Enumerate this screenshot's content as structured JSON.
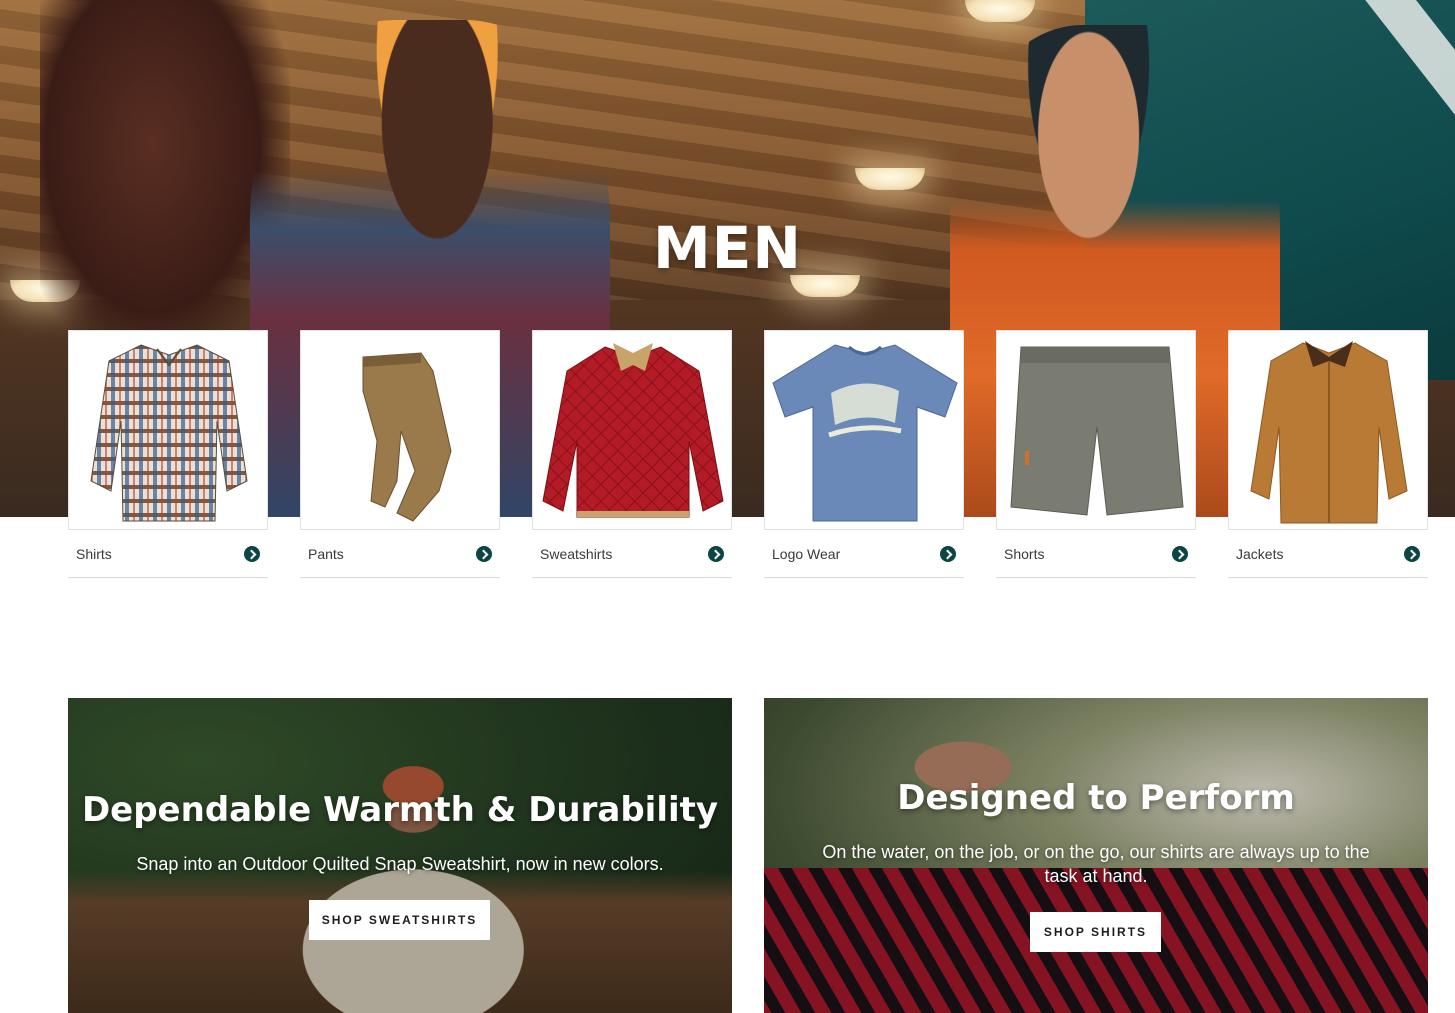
{
  "hero": {
    "title": "MEN"
  },
  "categories": [
    {
      "label": "Shirts",
      "icon": "plaid-shirt-image"
    },
    {
      "label": "Pants",
      "icon": "khaki-pants-image"
    },
    {
      "label": "Sweatshirts",
      "icon": "red-quilted-pullover-image"
    },
    {
      "label": "Logo Wear",
      "icon": "blue-logo-tee-image"
    },
    {
      "label": "Shorts",
      "icon": "gray-shorts-image"
    },
    {
      "label": "Jackets",
      "icon": "tan-jacket-image"
    }
  ],
  "promos": {
    "left": {
      "headline": "Dependable Warmth & Durability",
      "subtext": "Snap into an Outdoor Quilted Snap Sweatshirt, now in new colors.",
      "cta": "SHOP SWEATSHIRTS"
    },
    "right": {
      "headline": "Designed to Perform",
      "subtext": "On the water, on the job, or on the go, our shirts are always up to the task at hand.",
      "cta": "SHOP SHIRTS"
    }
  },
  "colors": {
    "accent": "#0d4546",
    "divider": "#d9d9d9",
    "text": "#3a3a3a"
  }
}
